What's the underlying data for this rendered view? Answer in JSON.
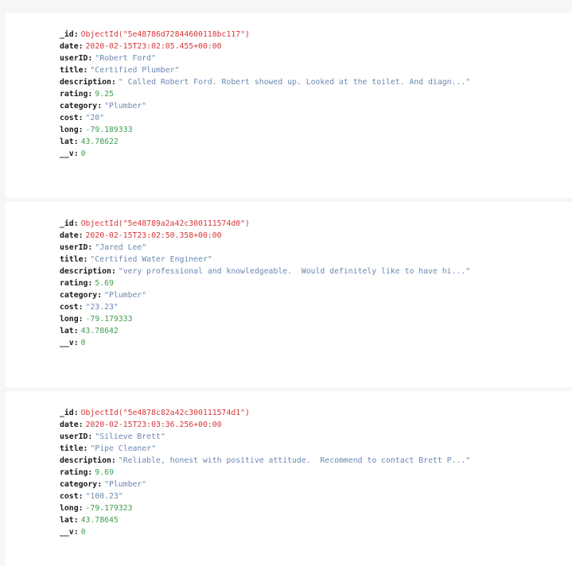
{
  "documents": [
    {
      "fields": [
        {
          "key": "_id",
          "value": "ObjectId(\"5e48786d72844600118bc117\")",
          "kind": "oid"
        },
        {
          "key": "date",
          "value": "2020-02-15T23:02:05.455+00:00",
          "kind": "date"
        },
        {
          "key": "userID",
          "value": "\"Robert Ford\"",
          "kind": "str"
        },
        {
          "key": "title",
          "value": "\"Certified Plumber\"",
          "kind": "str"
        },
        {
          "key": "description",
          "value": "\" Called Robert Ford. Robert showed up. Looked at the toilet. And diagn...\"",
          "kind": "str"
        },
        {
          "key": "rating",
          "value": "9.25",
          "kind": "num"
        },
        {
          "key": "category",
          "value": "\"Plumber\"",
          "kind": "str"
        },
        {
          "key": "cost",
          "value": "\"20\"",
          "kind": "str"
        },
        {
          "key": "long",
          "value": "-79.189333",
          "kind": "num"
        },
        {
          "key": "lat",
          "value": "43.78622",
          "kind": "num"
        },
        {
          "key": "__v",
          "value": "0",
          "kind": "num"
        }
      ]
    },
    {
      "fields": [
        {
          "key": "_id",
          "value": "ObjectId(\"5e48789a2a42c300111574d0\")",
          "kind": "oid"
        },
        {
          "key": "date",
          "value": "2020-02-15T23:02:50.358+00:00",
          "kind": "date"
        },
        {
          "key": "userID",
          "value": "\"Jared Lee\"",
          "kind": "str"
        },
        {
          "key": "title",
          "value": "\"Certified Water Engineer\"",
          "kind": "str"
        },
        {
          "key": "description",
          "value": "\"very professional and knowledgeable.  Would definitely like to have hi...\"",
          "kind": "str"
        },
        {
          "key": "rating",
          "value": "5.69",
          "kind": "num"
        },
        {
          "key": "category",
          "value": "\"Plumber\"",
          "kind": "str"
        },
        {
          "key": "cost",
          "value": "\"23.23\"",
          "kind": "str"
        },
        {
          "key": "long",
          "value": "-79.179333",
          "kind": "num"
        },
        {
          "key": "lat",
          "value": "43.78642",
          "kind": "num"
        },
        {
          "key": "__v",
          "value": "0",
          "kind": "num"
        }
      ]
    },
    {
      "fields": [
        {
          "key": "_id",
          "value": "ObjectId(\"5e4878c82a42c300111574d1\")",
          "kind": "oid"
        },
        {
          "key": "date",
          "value": "2020-02-15T23:03:36.256+00:00",
          "kind": "date"
        },
        {
          "key": "userID",
          "value": "\"Silieve Brett\"",
          "kind": "str"
        },
        {
          "key": "title",
          "value": "\"Pipe Cleaner\"",
          "kind": "str"
        },
        {
          "key": "description",
          "value": "\"Reliable, honest with positive attitude.  Recommend to contact Brett P...\"",
          "kind": "str"
        },
        {
          "key": "rating",
          "value": "9.69",
          "kind": "num"
        },
        {
          "key": "category",
          "value": "\"Plumber\"",
          "kind": "str"
        },
        {
          "key": "cost",
          "value": "\"100.23\"",
          "kind": "str"
        },
        {
          "key": "long",
          "value": "-79.179323",
          "kind": "num"
        },
        {
          "key": "lat",
          "value": "43.78645",
          "kind": "num"
        },
        {
          "key": "__v",
          "value": "0",
          "kind": "num"
        }
      ]
    }
  ],
  "colors": {
    "key": "#1a1a1a",
    "object_id": "#d6373a",
    "date": "#d6373a",
    "string": "#6b88b2",
    "number": "#3f9e4f",
    "card_background": "#ffffff",
    "page_background": "#f5f6f7"
  }
}
